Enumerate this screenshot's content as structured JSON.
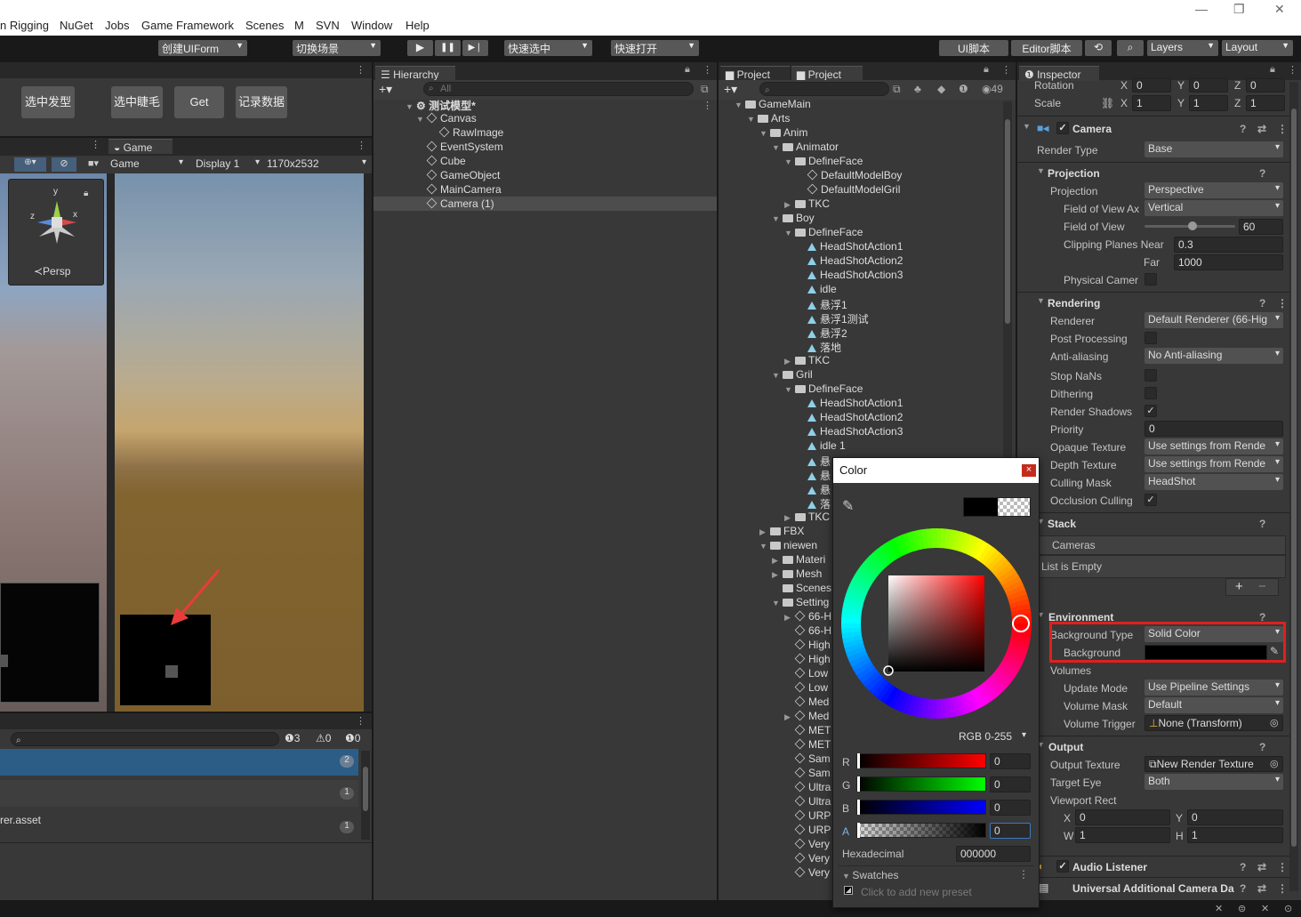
{
  "menu": {
    "items": [
      "n Rigging",
      "NuGet",
      "Jobs",
      "Game Framework",
      "Scenes",
      "M",
      "SVN",
      "Window",
      "Help"
    ],
    "win_controls": [
      "—",
      "❐",
      "✕"
    ]
  },
  "toolbar": {
    "create_uiform": "创建UIForm",
    "switch_scene": "切换场景",
    "quick_select": "快速选中",
    "quick_open": "快速打开",
    "ui_script": "UI脚本",
    "editor_script": "Editor脚本",
    "layers": "Layers",
    "layout": "Layout",
    "play": "▶",
    "pause": "❚❚",
    "step": "▶❘"
  },
  "scene_panel": {
    "buttons": [
      "选中发型",
      "选中睫毛",
      "Get",
      "记录数据"
    ],
    "persp": "≺Persp",
    "gizmo": {
      "y": "y",
      "z": "z",
      "x": "x"
    }
  },
  "game_panel": {
    "tab": "Game",
    "mode": "Game",
    "display": "Display 1",
    "resolution": "1170x2532"
  },
  "console": {
    "counts": {
      "info": "3",
      "warn": "0",
      "error": "0"
    },
    "rows": [
      {
        "text": "",
        "count": "2"
      },
      {
        "text": "",
        "count": "1"
      },
      {
        "text": "rer.asset",
        "count": "1"
      }
    ]
  },
  "hierarchy": {
    "tab": "Hierarchy",
    "search_placeholder": "All",
    "add": "+▾",
    "scene": "测试模型*",
    "items": [
      {
        "label": "Canvas",
        "depth": 1
      },
      {
        "label": "RawImage",
        "depth": 2
      },
      {
        "label": "EventSystem",
        "depth": 1
      },
      {
        "label": "Cube",
        "depth": 1
      },
      {
        "label": "GameObject",
        "depth": 1
      },
      {
        "label": "MainCamera",
        "depth": 1
      },
      {
        "label": "Camera (1)",
        "depth": 1
      }
    ]
  },
  "project": {
    "tabs": [
      "Project",
      "Project"
    ],
    "hidden_count": "49",
    "add": "+▾",
    "rows": [
      {
        "label": "GameMain",
        "d": 0,
        "k": "f",
        "o": true
      },
      {
        "label": "Arts",
        "d": 1,
        "k": "f",
        "o": true
      },
      {
        "label": "Anim",
        "d": 2,
        "k": "f",
        "o": true
      },
      {
        "label": "Animator",
        "d": 3,
        "k": "f",
        "o": true
      },
      {
        "label": "DefineFace",
        "d": 4,
        "k": "f",
        "o": true
      },
      {
        "label": "DefaultModelBoy",
        "d": 5,
        "k": "c"
      },
      {
        "label": "DefaultModelGril",
        "d": 5,
        "k": "c"
      },
      {
        "label": "TKC",
        "d": 4,
        "k": "f",
        "o": false
      },
      {
        "label": "Boy",
        "d": 3,
        "k": "f",
        "o": true
      },
      {
        "label": "DefineFace",
        "d": 4,
        "k": "f",
        "o": true
      },
      {
        "label": "HeadShotAction1",
        "d": 5,
        "k": "a"
      },
      {
        "label": "HeadShotAction2",
        "d": 5,
        "k": "a"
      },
      {
        "label": "HeadShotAction3",
        "d": 5,
        "k": "a"
      },
      {
        "label": "idle",
        "d": 5,
        "k": "a"
      },
      {
        "label": "悬浮1",
        "d": 5,
        "k": "a"
      },
      {
        "label": "悬浮1测试",
        "d": 5,
        "k": "a"
      },
      {
        "label": "悬浮2",
        "d": 5,
        "k": "a"
      },
      {
        "label": "落地",
        "d": 5,
        "k": "a"
      },
      {
        "label": "TKC",
        "d": 4,
        "k": "f",
        "o": false
      },
      {
        "label": "Gril",
        "d": 3,
        "k": "f",
        "o": true
      },
      {
        "label": "DefineFace",
        "d": 4,
        "k": "f",
        "o": true
      },
      {
        "label": "HeadShotAction1",
        "d": 5,
        "k": "a"
      },
      {
        "label": "HeadShotAction2",
        "d": 5,
        "k": "a"
      },
      {
        "label": "HeadShotAction3",
        "d": 5,
        "k": "a"
      },
      {
        "label": "idle 1",
        "d": 5,
        "k": "a"
      },
      {
        "label": "悬",
        "d": 5,
        "k": "a"
      },
      {
        "label": "悬",
        "d": 5,
        "k": "a"
      },
      {
        "label": "悬",
        "d": 5,
        "k": "a"
      },
      {
        "label": "落",
        "d": 5,
        "k": "a"
      },
      {
        "label": "TKC",
        "d": 4,
        "k": "f",
        "o": false
      },
      {
        "label": "FBX",
        "d": 2,
        "k": "f",
        "o": false
      },
      {
        "label": "niewen",
        "d": 2,
        "k": "f",
        "o": true
      },
      {
        "label": "Materi",
        "d": 3,
        "k": "f",
        "o": false
      },
      {
        "label": "Mesh",
        "d": 3,
        "k": "f",
        "o": false
      },
      {
        "label": "Scenes",
        "d": 3,
        "k": "f",
        "o": null
      },
      {
        "label": "Setting",
        "d": 3,
        "k": "f",
        "o": true
      },
      {
        "label": "66-H",
        "d": 4,
        "k": "c",
        "o": false
      },
      {
        "label": "66-H",
        "d": 4,
        "k": "c"
      },
      {
        "label": "High",
        "d": 4,
        "k": "c"
      },
      {
        "label": "High",
        "d": 4,
        "k": "c"
      },
      {
        "label": "Low",
        "d": 4,
        "k": "c"
      },
      {
        "label": "Low",
        "d": 4,
        "k": "c"
      },
      {
        "label": "Med",
        "d": 4,
        "k": "c"
      },
      {
        "label": "Med",
        "d": 4,
        "k": "c",
        "o": false
      },
      {
        "label": "MET",
        "d": 4,
        "k": "c"
      },
      {
        "label": "MET",
        "d": 4,
        "k": "c"
      },
      {
        "label": "Sam",
        "d": 4,
        "k": "c"
      },
      {
        "label": "Sam",
        "d": 4,
        "k": "c"
      },
      {
        "label": "Ultra",
        "d": 4,
        "k": "c"
      },
      {
        "label": "Ultra",
        "d": 4,
        "k": "c"
      },
      {
        "label": "URP",
        "d": 4,
        "k": "c"
      },
      {
        "label": "URP",
        "d": 4,
        "k": "c"
      },
      {
        "label": "Very",
        "d": 4,
        "k": "c"
      },
      {
        "label": "Very",
        "d": 4,
        "k": "c"
      },
      {
        "label": "Very",
        "d": 4,
        "k": "c"
      }
    ]
  },
  "color_picker": {
    "title": "Color",
    "mode": "RGB 0-255",
    "channels": [
      {
        "name": "R",
        "value": "0"
      },
      {
        "name": "G",
        "value": "0"
      },
      {
        "name": "B",
        "value": "0"
      },
      {
        "name": "A",
        "value": "0"
      }
    ],
    "hex_label": "Hexadecimal",
    "hex_value": "000000",
    "swatches": "Swatches",
    "add_preset": "Click to add new preset",
    "close": "×"
  },
  "inspector": {
    "tab": "Inspector",
    "transform": {
      "rotation": "Rotation",
      "scale": "Scale",
      "rot": {
        "x": "0",
        "y": "0",
        "z": "0"
      },
      "scl": {
        "x": "1",
        "y": "1",
        "z": "1"
      }
    },
    "camera": {
      "title": "Camera",
      "render_type_label": "Render Type",
      "render_type": "Base"
    },
    "projection": {
      "title": "Projection",
      "projection_label": "Projection",
      "projection": "Perspective",
      "fov_axis_label": "Field of View Ax",
      "fov_axis": "Vertical",
      "fov_label": "Field of View",
      "fov": "60",
      "fov_fraction": 0.226,
      "near_label": "Clipping Planes Near",
      "near": "0.3",
      "far_label": "Far",
      "far": "1000",
      "physical_label": "Physical Camer"
    },
    "rendering": {
      "title": "Rendering",
      "renderer_label": "Renderer",
      "renderer": "Default Renderer (66-Hig",
      "post_label": "Post Processing",
      "aa_label": "Anti-aliasing",
      "aa": "No Anti-aliasing",
      "nans_label": "Stop NaNs",
      "dither_label": "Dithering",
      "shadows_label": "Render Shadows",
      "priority_label": "Priority",
      "priority": "0",
      "opaque_label": "Opaque Texture",
      "opaque": "Use settings from Rende",
      "depth_label": "Depth Texture",
      "depth": "Use settings from Rende",
      "mask_label": "Culling Mask",
      "mask": "HeadShot",
      "occ_label": "Occlusion Culling"
    },
    "stack": {
      "title": "Stack",
      "cameras": "Cameras",
      "empty": "List is Empty"
    },
    "environment": {
      "title": "Environment",
      "bg_type_label": "Background Type",
      "bg_type": "Solid Color",
      "bg_label": "Background",
      "bg_color": "#000000",
      "volumes": "Volumes",
      "update_label": "Update Mode",
      "update": "Use Pipeline Settings",
      "vmask_label": "Volume Mask",
      "vmask": "Default",
      "trigger_label": "Volume Trigger",
      "trigger": "None (Transform)"
    },
    "output": {
      "title": "Output",
      "tex_label": "Output Texture",
      "tex": "New Render Texture",
      "eye_label": "Target Eye",
      "eye": "Both",
      "vp_label": "Viewport Rect",
      "vx": "0",
      "vy": "0",
      "vw": "1",
      "vh": "1"
    },
    "audio": {
      "title": "Audio Listener"
    },
    "uacd": {
      "title": "Universal Additional Camera Da"
    }
  },
  "colors": {
    "highlight_red": "#e02020",
    "selection_blue": "#2c5d87",
    "accent_arrow": "#e83c3c"
  }
}
